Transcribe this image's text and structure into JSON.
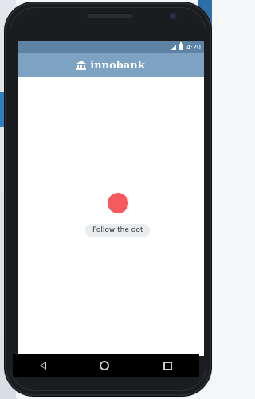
{
  "status_bar": {
    "time": "4:20",
    "signal_icon": "signal-icon",
    "battery_icon": "battery-icon"
  },
  "app_bar": {
    "logo_icon": "bank-icon",
    "title": "innobank"
  },
  "main": {
    "dot_color": "#f45a5e",
    "hint_label": "Follow the dot"
  },
  "nav_bar": {
    "back_icon": "back-icon",
    "home_icon": "home-icon",
    "recents_icon": "recents-icon"
  },
  "colors": {
    "status_bar": "#5d82a3",
    "app_bar": "#7ea2c1",
    "hint_background": "#eaedf0"
  }
}
